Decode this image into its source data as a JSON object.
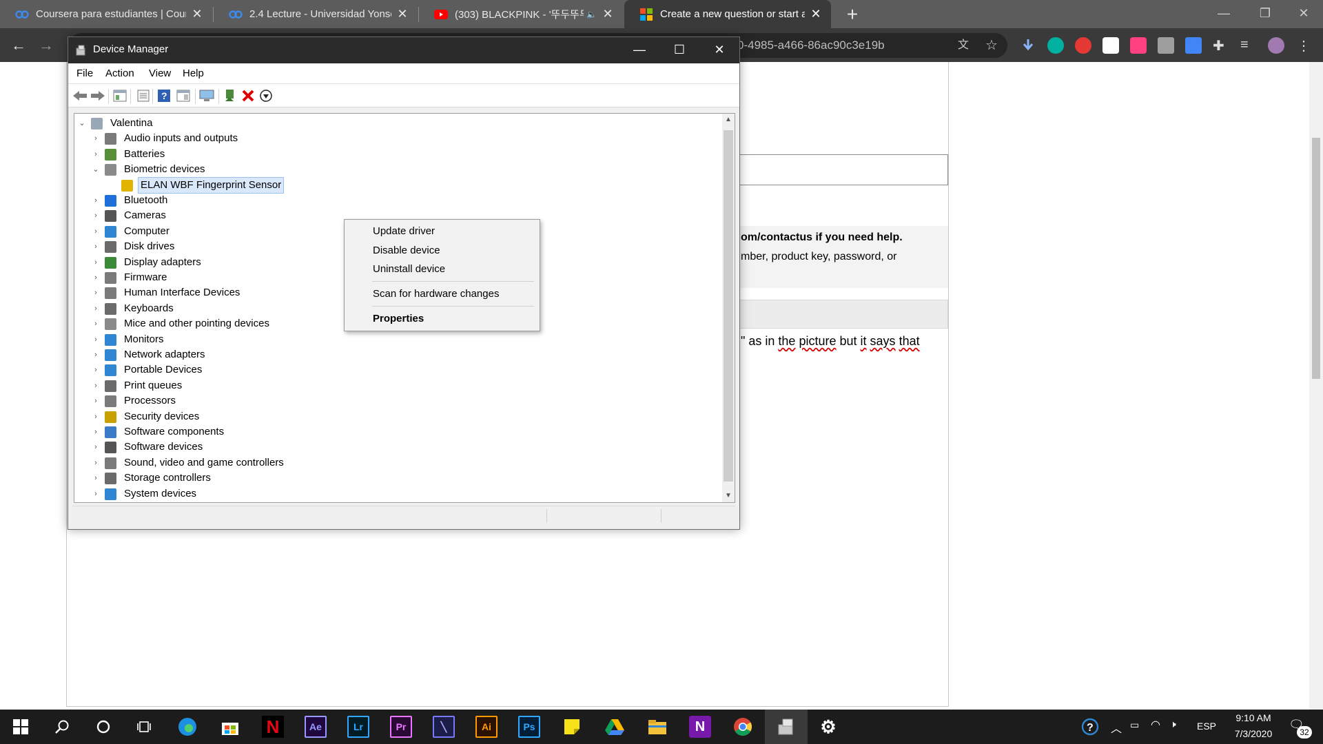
{
  "browser": {
    "tabs": [
      {
        "title": "Coursera para estudiantes | Cour",
        "favicon": "coursera-icon",
        "active": false
      },
      {
        "title": "2.4 Lecture - Universidad Yonsei |",
        "favicon": "coursera-icon",
        "active": false
      },
      {
        "title": "(303) BLACKPINK - '뚜두뚜두",
        "favicon": "youtube-icon",
        "active": false
      },
      {
        "title": "Create a new question or start a",
        "favicon": "microsoft-icon",
        "active": true
      }
    ],
    "url_fragment": "0-4985-a466-86ac90c3e19b"
  },
  "page": {
    "notice_bold": "om/contactus if you need help.",
    "notice_text": "mber, product key, password, or",
    "body_parts": [
      "\" as in ",
      "the",
      " ",
      "picture",
      " but ",
      "it",
      " ",
      "says",
      " ",
      "that"
    ]
  },
  "devmgr": {
    "title": "Device Manager",
    "menu": [
      "File",
      "Action",
      "View",
      "Help"
    ],
    "root": "Valentina",
    "tree": [
      {
        "label": "Audio inputs and outputs",
        "expanded": false,
        "icon": "speaker-icon",
        "color": "#7a7a7a"
      },
      {
        "label": "Batteries",
        "expanded": false,
        "icon": "battery-icon",
        "color": "#5a8f3a"
      },
      {
        "label": "Biometric devices",
        "expanded": true,
        "icon": "biometric-icon",
        "color": "#8a8a8a"
      },
      {
        "label": "ELAN WBF Fingerprint Sensor",
        "child": true,
        "selected": true,
        "icon": "warning-device-icon",
        "color": "#e0b400"
      },
      {
        "label": "Bluetooth",
        "expanded": false,
        "icon": "bluetooth-icon",
        "color": "#1e6fd9"
      },
      {
        "label": "Cameras",
        "expanded": false,
        "icon": "camera-icon",
        "color": "#555555"
      },
      {
        "label": "Computer",
        "expanded": false,
        "icon": "computer-icon",
        "color": "#2f86d3"
      },
      {
        "label": "Disk drives",
        "expanded": false,
        "icon": "disk-icon",
        "color": "#6b6b6b"
      },
      {
        "label": "Display adapters",
        "expanded": false,
        "icon": "display-adapter-icon",
        "color": "#3a8a3a"
      },
      {
        "label": "Firmware",
        "expanded": false,
        "icon": "firmware-icon",
        "color": "#7a7a7a"
      },
      {
        "label": "Human Interface Devices",
        "expanded": false,
        "icon": "hid-icon",
        "color": "#7a7a7a"
      },
      {
        "label": "Keyboards",
        "expanded": false,
        "icon": "keyboard-icon",
        "color": "#6b6b6b"
      },
      {
        "label": "Mice and other pointing devices",
        "expanded": false,
        "icon": "mouse-icon",
        "color": "#8a8a8a"
      },
      {
        "label": "Monitors",
        "expanded": false,
        "icon": "monitor-icon",
        "color": "#2f86d3"
      },
      {
        "label": "Network adapters",
        "expanded": false,
        "icon": "network-icon",
        "color": "#2f86d3"
      },
      {
        "label": "Portable Devices",
        "expanded": false,
        "icon": "portable-device-icon",
        "color": "#2f86d3"
      },
      {
        "label": "Print queues",
        "expanded": false,
        "icon": "printer-icon",
        "color": "#6b6b6b"
      },
      {
        "label": "Processors",
        "expanded": false,
        "icon": "processor-icon",
        "color": "#7a7a7a"
      },
      {
        "label": "Security devices",
        "expanded": false,
        "icon": "security-icon",
        "color": "#c8a000"
      },
      {
        "label": "Software components",
        "expanded": false,
        "icon": "software-component-icon",
        "color": "#3a7ac8"
      },
      {
        "label": "Software devices",
        "expanded": false,
        "icon": "software-device-icon",
        "color": "#555555"
      },
      {
        "label": "Sound, video and game controllers",
        "expanded": false,
        "icon": "sound-icon",
        "color": "#7a7a7a"
      },
      {
        "label": "Storage controllers",
        "expanded": false,
        "icon": "storage-icon",
        "color": "#6b6b6b"
      },
      {
        "label": "System devices",
        "expanded": false,
        "icon": "system-device-icon",
        "color": "#2f86d3"
      }
    ],
    "context_menu": {
      "update": "Update driver",
      "disable": "Disable device",
      "uninstall": "Uninstall device",
      "scan": "Scan for hardware changes",
      "properties": "Properties"
    }
  },
  "taskbar": {
    "apps": [
      {
        "name": "search-icon"
      },
      {
        "name": "cortana-icon"
      },
      {
        "name": "task-view-icon"
      },
      {
        "name": "edge-icon"
      },
      {
        "name": "store-icon"
      },
      {
        "name": "netflix-icon",
        "text": "N"
      },
      {
        "name": "after-effects-icon",
        "text": "Ae"
      },
      {
        "name": "lightroom-icon",
        "text": "Lr"
      },
      {
        "name": "premiere-icon",
        "text": "Pr"
      },
      {
        "name": "vs-icon"
      },
      {
        "name": "illustrator-icon",
        "text": "Ai"
      },
      {
        "name": "photoshop-icon",
        "text": "Ps"
      },
      {
        "name": "sticky-notes-icon"
      },
      {
        "name": "drive-icon"
      },
      {
        "name": "file-explorer-icon"
      },
      {
        "name": "onenote-icon",
        "text": "N"
      },
      {
        "name": "chrome-icon"
      },
      {
        "name": "device-manager-icon"
      },
      {
        "name": "settings-icon"
      }
    ],
    "language": "ESP",
    "time": "9:10 AM",
    "date": "7/3/2020",
    "notifications": "32"
  }
}
